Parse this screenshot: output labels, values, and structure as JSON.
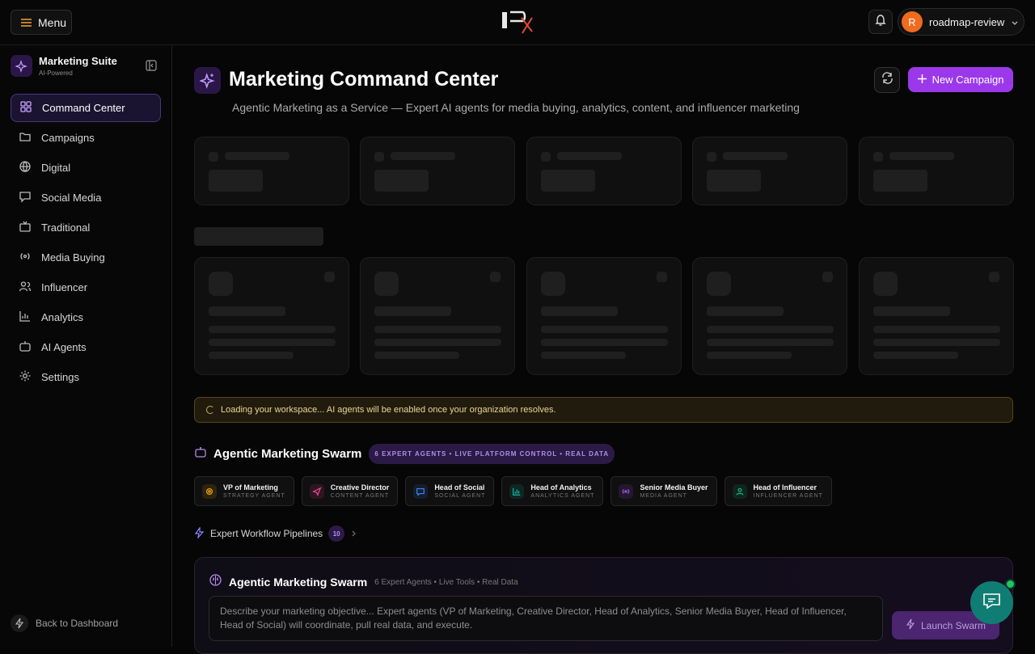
{
  "header": {
    "menu_label": "Menu",
    "user": {
      "initial": "R",
      "name": "roadmap-review"
    }
  },
  "sidebar": {
    "suite_title": "Marketing Suite",
    "suite_subtitle": "AI-Powered",
    "items": [
      {
        "label": "Command Center",
        "icon": "command-center-icon",
        "active": true
      },
      {
        "label": "Campaigns",
        "icon": "folder-icon"
      },
      {
        "label": "Digital",
        "icon": "globe-icon"
      },
      {
        "label": "Social Media",
        "icon": "chat-bubble-icon"
      },
      {
        "label": "Traditional",
        "icon": "tv-icon"
      },
      {
        "label": "Media Buying",
        "icon": "broadcast-icon"
      },
      {
        "label": "Influencer",
        "icon": "users-icon"
      },
      {
        "label": "Analytics",
        "icon": "bar-chart-icon"
      },
      {
        "label": "AI Agents",
        "icon": "robot-icon"
      },
      {
        "label": "Settings",
        "icon": "gear-icon"
      }
    ],
    "back_label": "Back to Dashboard"
  },
  "main": {
    "title": "Marketing Command Center",
    "subtitle": "Agentic Marketing as a Service — Expert AI agents for media buying, analytics, content, and influencer marketing",
    "new_campaign_label": "New Campaign",
    "loading_message": "Loading your workspace... AI agents will be enabled once your organization resolves.",
    "swarm": {
      "title": "Agentic Marketing Swarm",
      "badge": "6 EXPERT AGENTS • LIVE PLATFORM CONTROL • REAL DATA",
      "agents": [
        {
          "name": "VP of Marketing",
          "role": "STRATEGY AGENT",
          "color": "#f4a60b"
        },
        {
          "name": "Creative Director",
          "role": "CONTENT AGENT",
          "color": "#ec4899"
        },
        {
          "name": "Head of Social",
          "role": "SOCIAL AGENT",
          "color": "#3b82f6"
        },
        {
          "name": "Head of Analytics",
          "role": "ANALYTICS AGENT",
          "color": "#14b8a6"
        },
        {
          "name": "Senior Media Buyer",
          "role": "MEDIA AGENT",
          "color": "#a855f7"
        },
        {
          "name": "Head of Influencer",
          "role": "INFLUENCER AGENT",
          "color": "#10b981"
        }
      ],
      "pipeline_label": "Expert Workflow Pipelines",
      "pipeline_count": "10",
      "panel_title": "Agentic Marketing Swarm",
      "panel_meta": "6 Expert Agents • Live Tools • Real Data",
      "objective_placeholder": "Describe your marketing objective... Expert agents (VP of Marketing, Creative Director, Head of Analytics, Senior Media Buyer, Head of Influencer, Head of Social) will coordinate, pull real data, and execute.",
      "launch_label": "Launch Swarm"
    }
  },
  "colors": {
    "accent": "#9b39ea",
    "warning": "#ecd594",
    "chat": "#0f7d73"
  }
}
